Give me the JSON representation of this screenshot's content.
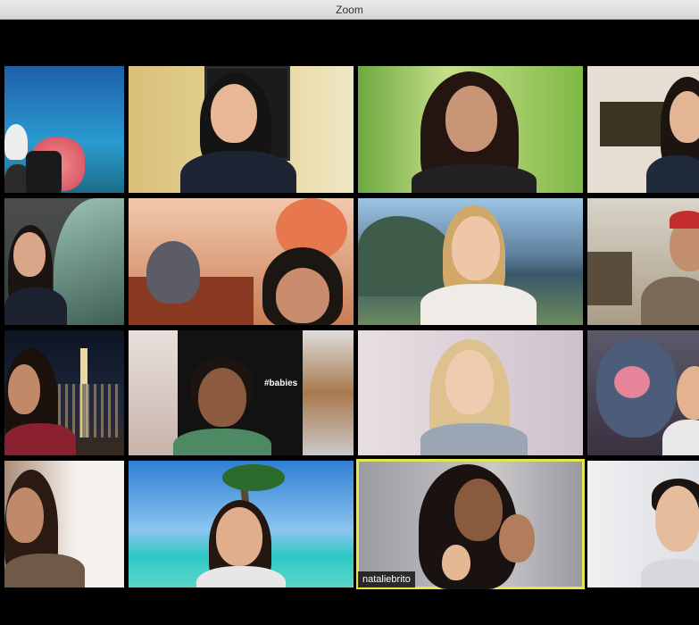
{
  "window": {
    "title": "Zoom"
  },
  "tiles": {
    "active_name": "nataliebrito",
    "babies_caption": "#babies"
  },
  "colors": {
    "active_border": "#e2e84a",
    "window_bg": "#000000"
  }
}
